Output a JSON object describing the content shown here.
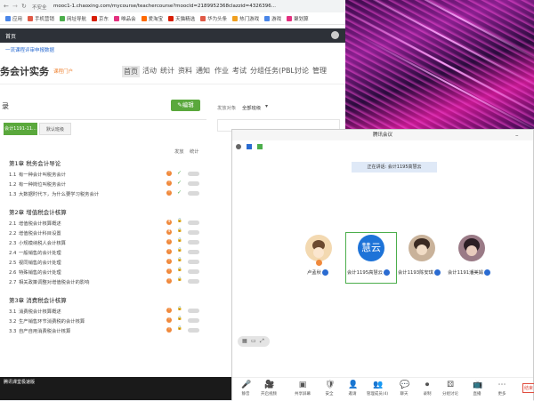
{
  "browser": {
    "security_label": "不安全",
    "url": "mooc1-1.chaoxing.com/mycourse/teachercourse?moocId=2189952368clazzid=4326396...",
    "bookmarks": [
      {
        "label": "应用",
        "color": "#4a86e8"
      },
      {
        "label": "手机营销",
        "color": "#e05a47"
      },
      {
        "label": "网址导航",
        "color": "#4cae4c"
      },
      {
        "label": "京东",
        "color": "#d81e06"
      },
      {
        "label": "唯品会",
        "color": "#e3307f"
      },
      {
        "label": "爱淘宝",
        "color": "#ff6a00"
      },
      {
        "label": "天猫精选",
        "color": "#d81e06"
      },
      {
        "label": "华为头条",
        "color": "#e05a47"
      },
      {
        "label": "热门游戏",
        "color": "#f0a020"
      },
      {
        "label": "游戏",
        "color": "#4a86e8"
      },
      {
        "label": "聚划算",
        "color": "#e3307f"
      }
    ]
  },
  "course": {
    "tab_label": "首页",
    "notice": "一流课程评审申报数据",
    "title_partial": "务会计实务",
    "portal_link": "课程门户",
    "nav": [
      "首页",
      "活动",
      "统计",
      "资料",
      "通知",
      "作业",
      "考试",
      "分组任务(PBL)",
      "讨论",
      "管理"
    ],
    "sidebar_title": "录",
    "edit_button": "编辑",
    "class_tabs": [
      "会计1191-11...",
      "默认班级"
    ],
    "col_publish": "发放",
    "col_stats": "统计",
    "chapters": [
      {
        "title": "第1章 税务会计导论",
        "lessons": [
          {
            "num": "1.1",
            "title": "有一种会计叫税务会计",
            "badge": "!",
            "status": "done"
          },
          {
            "num": "1.2",
            "title": "有一种岗位叫税务会计",
            "badge": "!",
            "status": "done"
          },
          {
            "num": "1.3",
            "title": "大数据时代下，为什么要学习税务会计",
            "badge": "!",
            "status": "done"
          }
        ]
      },
      {
        "title": "第2章 增值税会计核算",
        "lessons": [
          {
            "num": "2.1",
            "title": "增值税会计核算概述",
            "badge": "4",
            "status": "lock"
          },
          {
            "num": "2.2",
            "title": "增值税会计科目设置",
            "badge": "4",
            "status": "lock"
          },
          {
            "num": "2.3",
            "title": "小规模纳税人会计核算",
            "badge": "!",
            "status": "lock"
          },
          {
            "num": "2.4",
            "title": "一般销售的会计处理",
            "badge": "!",
            "status": "lock"
          },
          {
            "num": "2.5",
            "title": "视同销售的会计处理",
            "badge": "!",
            "status": "lock"
          },
          {
            "num": "2.6",
            "title": "特殊销售的会计处理",
            "badge": "!",
            "status": "lock"
          },
          {
            "num": "2.7",
            "title": "相关政策调整对增值税会计的影响",
            "badge": "!",
            "status": "lock"
          }
        ]
      },
      {
        "title": "第3章 消费税会计核算",
        "lessons": [
          {
            "num": "3.1",
            "title": "消费税会计核算概述",
            "badge": "!",
            "status": "lock"
          },
          {
            "num": "3.2",
            "title": "生产销售环节消费税的会计核算",
            "badge": "!",
            "status": "lock"
          },
          {
            "num": "3.3",
            "title": "自产自用消费税会计核算",
            "badge": "!",
            "status": "lock"
          }
        ]
      }
    ],
    "right_label": "发放对象",
    "right_select": "全部班级"
  },
  "meeting": {
    "title": "腾讯会议",
    "speaking_banner": "正在讲话: 会计1195高慧云",
    "participants": [
      {
        "name": "卢孟秋",
        "avatar_color": "#f3d9b1"
      },
      {
        "name": "会计1195高慧云",
        "avatar_text": "慧云",
        "avatar_color": "#1e73d8"
      },
      {
        "name": "会计1193陈安琪",
        "avatar_color": "#c9b29a"
      },
      {
        "name": "会计1191潘美娟",
        "avatar_color": "#9a7a86"
      }
    ],
    "toolbar": [
      {
        "label": "静音",
        "icon": "🎤"
      },
      {
        "label": "开启视频",
        "icon": "🎥"
      },
      {
        "label": "共享屏幕",
        "icon": "▣"
      },
      {
        "label": "安全",
        "icon": "🛡"
      },
      {
        "label": "邀请",
        "icon": "👤"
      },
      {
        "label": "管理成员(4)",
        "icon": "👥"
      },
      {
        "label": "聊天",
        "icon": "💬"
      },
      {
        "label": "录制",
        "icon": "⏺"
      },
      {
        "label": "分组讨论",
        "icon": "⚄"
      },
      {
        "label": "直播",
        "icon": "📺"
      },
      {
        "label": "更多",
        "icon": "⋯"
      }
    ],
    "end_button": "结束"
  },
  "taskbar": {
    "app_label": "腾讯课堂极速版"
  }
}
